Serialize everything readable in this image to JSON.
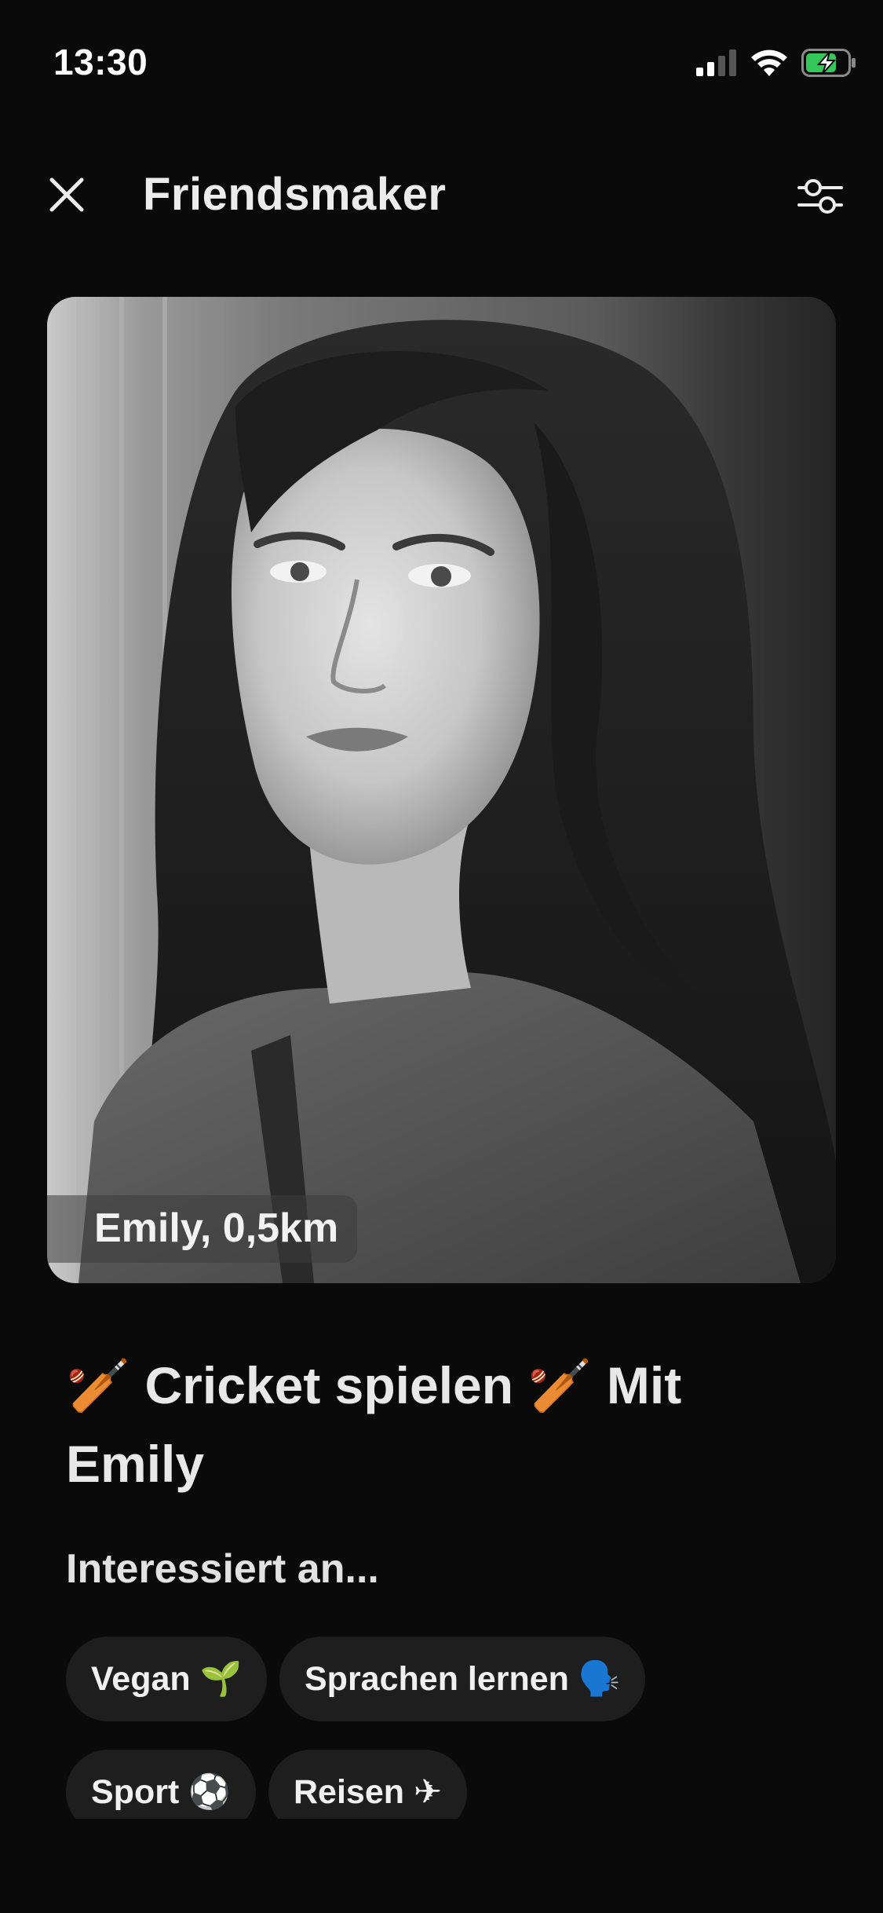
{
  "status_bar": {
    "time": "13:30"
  },
  "header": {
    "title": "Friendsmaker",
    "close_icon": "close-icon",
    "filter_icon": "sliders-filter-icon"
  },
  "profile": {
    "name_distance": "Emily, 0,5km",
    "photo_description_icon": "profile-photo"
  },
  "activity": {
    "title": "🏏 Cricket spielen 🏏 Mit Emily"
  },
  "interests": {
    "heading": "Interessiert an...",
    "chips": [
      {
        "label": "Vegan 🌱"
      },
      {
        "label": "Sprachen lernen 🗣️"
      },
      {
        "label": "Sport ⚽"
      },
      {
        "label": "Reisen ✈"
      }
    ]
  },
  "colors": {
    "background": "#0a0a0a",
    "chip_background": "#1e1e1e",
    "battery_green": "#34c759"
  }
}
